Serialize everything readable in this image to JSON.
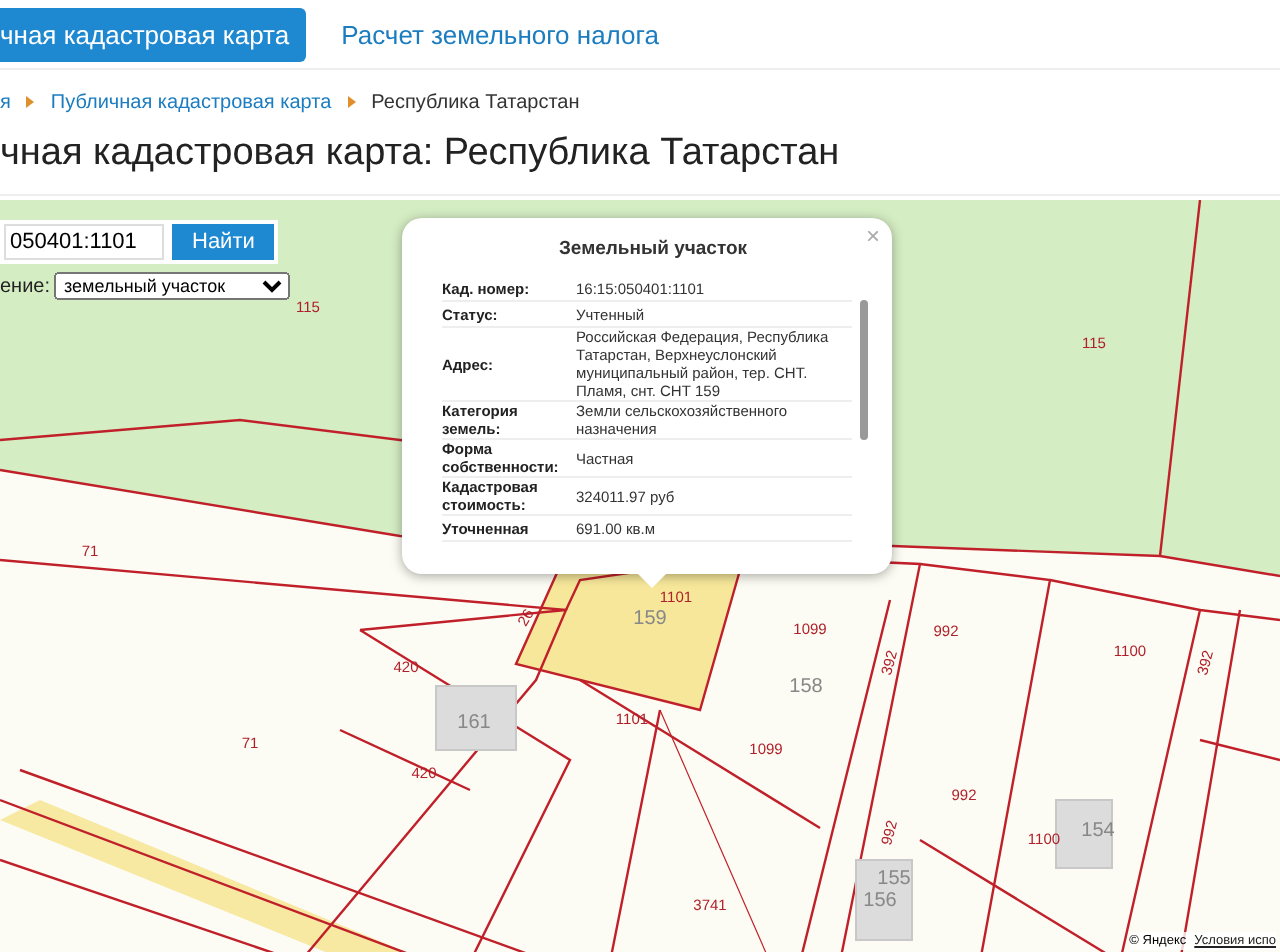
{
  "tabs": [
    {
      "label": "чная кадастровая карта",
      "selected": true
    },
    {
      "label": "Расчет земельного налога",
      "selected": false
    }
  ],
  "breadcrumbs": [
    "я",
    "Публичная кадастровая карта",
    "Республика Татарстан"
  ],
  "title": "чная кадастровая карта: Республика Татарстан",
  "search": {
    "value": "050401:1101",
    "button": "Найти"
  },
  "filter": {
    "label": "ение:",
    "value": "земельный участок"
  },
  "popup": {
    "title": "Земельный участок",
    "close": "×",
    "rows": [
      {
        "label": "Кад. номер:",
        "value": "16:15:050401:1101"
      },
      {
        "label": "Статус:",
        "value": "Учтенный"
      },
      {
        "label": "Адрес:",
        "value": "Российская Федерация, Республика Татарстан, Верхнеуслонский муниципальный район, тер. СНТ. Пламя, снт. СНТ 159"
      },
      {
        "label": "Категория земель:",
        "value": "Земли сельскохозяйственного назначения"
      },
      {
        "label": "Форма собственности:",
        "value": "Частная"
      },
      {
        "label": "Кадастровая стоимость:",
        "value": "324011.97 руб"
      },
      {
        "label": "Уточненная",
        "value": "691.00 кв.м"
      }
    ]
  },
  "map_labels": [
    "115",
    "115",
    "71",
    "71",
    "26",
    "1101",
    "159",
    "420",
    "420",
    "161",
    "1101",
    "158",
    "1099",
    "1099",
    "392",
    "992",
    "1100",
    "392",
    "992",
    "992",
    "1100",
    "154",
    "155",
    "156",
    "3741"
  ],
  "attribution": [
    "© Яндекс",
    "Условия испо"
  ]
}
